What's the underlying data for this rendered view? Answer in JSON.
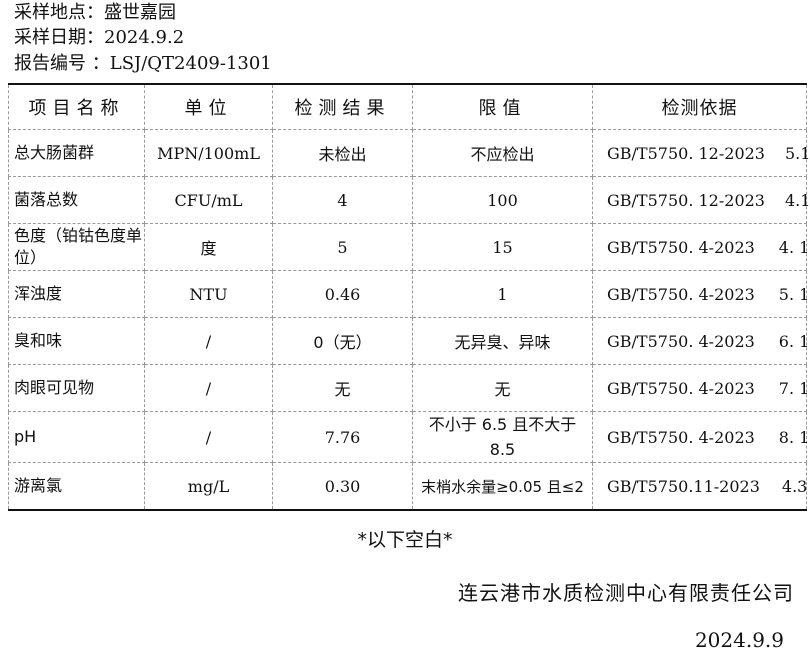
{
  "meta": {
    "location_label": "采样地点：",
    "location_value": "盛世嘉园",
    "date_label": "采样日期：",
    "date_value": "2024.9.2",
    "report_label": "报告编号 ：",
    "report_value": "LSJ/QT2409-1301"
  },
  "table": {
    "headers": [
      "项目名称",
      "单位",
      "检测结果",
      "限值",
      "检测依据"
    ],
    "rows": [
      {
        "name": "总大肠菌群",
        "unit": "MPN/100mL",
        "result": "未检出",
        "limit": "不应检出",
        "std": "GB/T5750. 12-2023",
        "clause": "5.1"
      },
      {
        "name": "菌落总数",
        "unit": "CFU/mL",
        "result": "4",
        "limit": "100",
        "std": "GB/T5750. 12-2023",
        "clause": "4.1"
      },
      {
        "name": "色度（铂钴色度单位）",
        "unit": "度",
        "result": "5",
        "limit": "15",
        "std": "GB/T5750. 4-2023",
        "clause": "4. 1"
      },
      {
        "name": "浑浊度",
        "unit": "NTU",
        "result": "0.46",
        "limit": "1",
        "std": "GB/T5750. 4-2023",
        "clause": "5. 1"
      },
      {
        "name": "臭和味",
        "unit": "/",
        "result": "0（无）",
        "limit": "无异臭、异味",
        "std": "GB/T5750. 4-2023",
        "clause": "6. 1"
      },
      {
        "name": "肉眼可见物",
        "unit": "/",
        "result": "无",
        "limit": "无",
        "std": "GB/T5750. 4-2023",
        "clause": "7. 1"
      },
      {
        "name": "pH",
        "unit": "/",
        "result": "7.76",
        "limit": "不小于 6.5 且不大于 8.5",
        "std": "GB/T5750. 4-2023",
        "clause": "8. 1"
      },
      {
        "name": "游离氯",
        "unit": "mg/L",
        "result": "0.30",
        "limit": "末梢水余量≥0.05 且≤2",
        "std": "GB/T5750.11-2023",
        "clause": "4.3"
      }
    ]
  },
  "footer": {
    "note": "*以下空白*",
    "organization": "连云港市水质检测中心有限责任公司",
    "date": "2024.9.9"
  }
}
